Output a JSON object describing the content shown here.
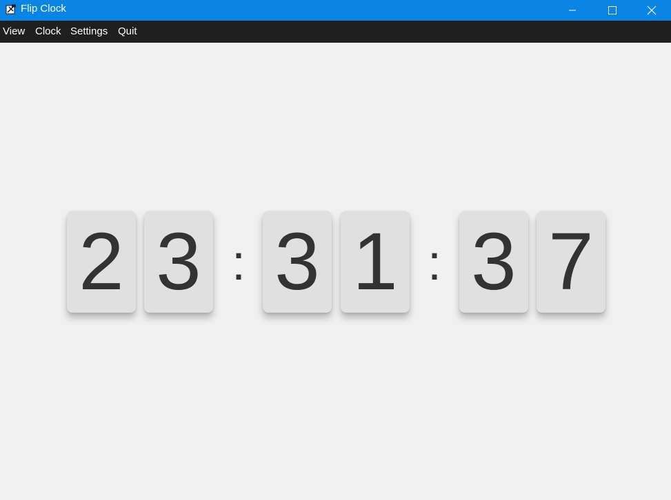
{
  "window": {
    "title": "Flip Clock",
    "icon": "flip-clock-app-icon",
    "accent_color": "#0a84e5",
    "controls": [
      "minimize-icon",
      "maximize-icon",
      "close-icon"
    ]
  },
  "menu": {
    "background_color": "#1f1f1f",
    "items": [
      {
        "label": "View"
      },
      {
        "label": "Clock"
      },
      {
        "label": "Settings"
      },
      {
        "label": "Quit"
      }
    ]
  },
  "clock": {
    "time": "23:31:37",
    "hours": [
      "2",
      "3"
    ],
    "minutes": [
      "3",
      "1"
    ],
    "seconds": [
      "3",
      "7"
    ],
    "separator": ":",
    "card_color": "#e0e0e0",
    "digit_color": "#333333",
    "background_color": "#f0f0f0"
  }
}
